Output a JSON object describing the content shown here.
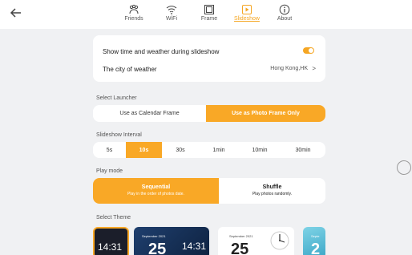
{
  "nav": {
    "tabs": [
      {
        "label": "Friends",
        "icon": "friends-icon"
      },
      {
        "label": "WiFi",
        "icon": "wifi-icon"
      },
      {
        "label": "Frame",
        "icon": "frame-icon"
      },
      {
        "label": "Slideshow",
        "icon": "slideshow-icon"
      },
      {
        "label": "About",
        "icon": "info-icon"
      }
    ],
    "active": "Slideshow"
  },
  "settings": {
    "show_time_label": "Show time and weather during slideshow",
    "show_time_on": true,
    "city_label": "The city of weather",
    "city_value": "Hong Kong,HK",
    "chevron": ">"
  },
  "launcher": {
    "title": "Select Launcher",
    "options": [
      "Use as Calendar Frame",
      "Use as Photo Frame Only"
    ],
    "selected": "Use as Photo Frame Only"
  },
  "interval": {
    "title": "Slideshow Interval",
    "options": [
      "5s",
      "10s",
      "30s",
      "1min",
      "10min",
      "30min"
    ],
    "selected": "10s"
  },
  "play_mode": {
    "title": "Play mode",
    "sequential": {
      "title": "Sequential",
      "subtitle": "Play in the order of photos date."
    },
    "shuffle": {
      "title": "Shuffle",
      "subtitle": "Play photos randomly."
    },
    "selected": "Sequential"
  },
  "theme": {
    "title": "Select Theme",
    "items": [
      {
        "time": "14:31"
      },
      {
        "month": "September 2021",
        "day": "25",
        "time": "14:31"
      },
      {
        "month": "September 2021",
        "day": "25"
      },
      {
        "month": "Septe",
        "day": "2"
      }
    ]
  },
  "colors": {
    "accent": "#f9a826",
    "background": "#f0f1f3"
  }
}
